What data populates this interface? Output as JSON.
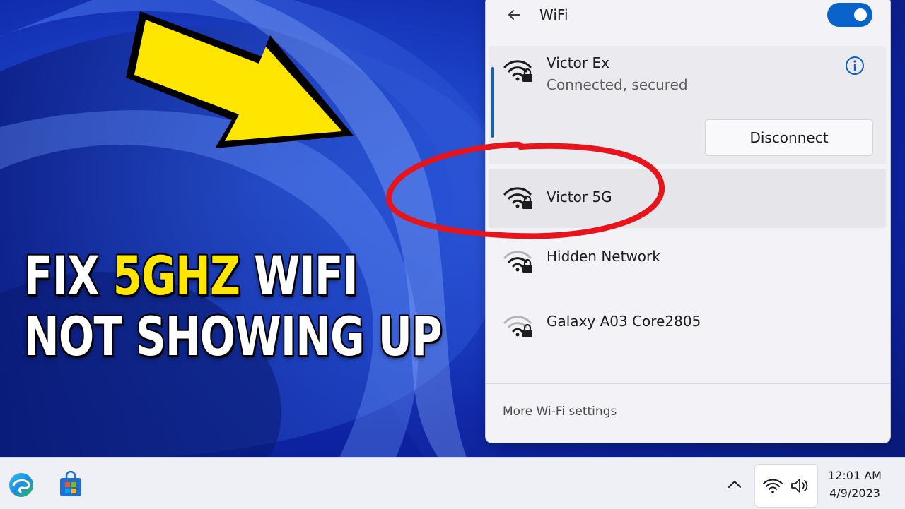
{
  "headline": {
    "line1_before": "FIX ",
    "line1_accent": "5GHZ",
    "line1_after": " WIFI",
    "line2": "NOT SHOWING UP"
  },
  "wifi_panel": {
    "title": "WiFi",
    "toggle_on": true,
    "connected": {
      "name": "Victor Ex",
      "status": "Connected, secured",
      "disconnect_label": "Disconnect"
    },
    "networks": [
      {
        "name": "Victor 5G",
        "secured": true,
        "highlighted": true
      },
      {
        "name": "Hidden Network",
        "secured": true,
        "highlighted": false
      },
      {
        "name": "Galaxy A03 Core2805",
        "secured": true,
        "highlighted": false
      }
    ],
    "more_settings_label": "More Wi-Fi settings"
  },
  "taskbar": {
    "apps": [
      "edge-icon",
      "store-icon"
    ],
    "time": "12:01 AM",
    "date": "4/9/2023"
  },
  "colors": {
    "accent_blue": "#0a63c9",
    "headline_yellow": "#ffe600",
    "annotation_red": "#e8141c"
  }
}
